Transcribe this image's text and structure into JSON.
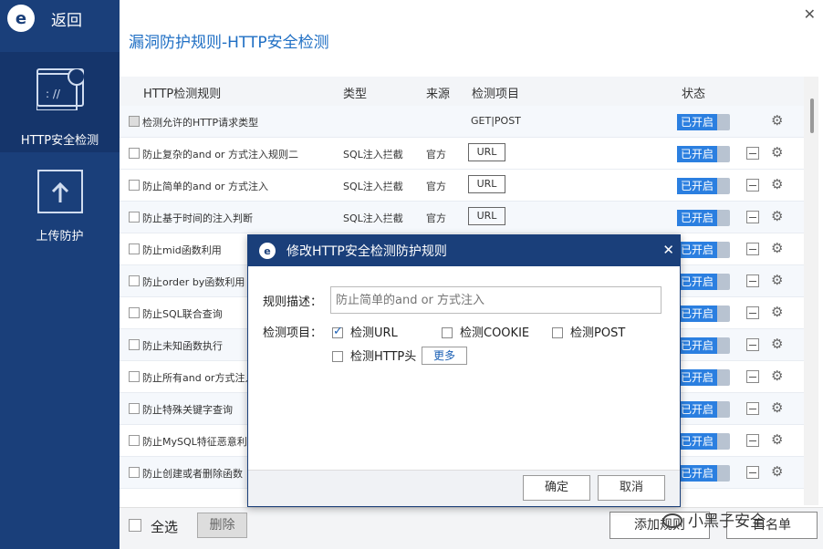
{
  "sidebar": {
    "back_label": "返回",
    "logo_glyph": "e",
    "items": [
      {
        "label": "HTTP安全检测",
        "icon_glyph": ": //"
      },
      {
        "label": "上传防护"
      }
    ]
  },
  "main": {
    "title": "漏洞防护规则-HTTP安全检测",
    "close_glyph": "✕",
    "columns": [
      "HTTP检测规则",
      "类型",
      "来源",
      "检测项目",
      "状态"
    ],
    "rows": [
      {
        "name": "检测允许的HTTP请求类型",
        "type": "",
        "source": "",
        "item": "GET|POST",
        "status": "已开启"
      },
      {
        "name": "防止复杂的and or 方式注入规则二",
        "type": "SQL注入拦截",
        "source": "官方",
        "item": "URL",
        "status": "已开启"
      },
      {
        "name": "防止简单的and or 方式注入",
        "type": "SQL注入拦截",
        "source": "官方",
        "item": "URL",
        "status": "已开启"
      },
      {
        "name": "防止基于时间的注入判断",
        "type": "SQL注入拦截",
        "source": "官方",
        "item": "URL",
        "status": "已开启"
      },
      {
        "name": "防止mid函数利用",
        "status": "已开启"
      },
      {
        "name": "防止order by函数利用",
        "status": "已开启"
      },
      {
        "name": "防止SQL联合查询",
        "status": "已开启"
      },
      {
        "name": "防止未知函数执行",
        "status": "已开启"
      },
      {
        "name": "防止所有and or方式注入",
        "status": "已开启"
      },
      {
        "name": "防止特殊关键字查询",
        "status": "已开启"
      },
      {
        "name": "防止MySQL特征恶意利",
        "status": "已开启"
      },
      {
        "name": "防止创建或者删除函数",
        "status": "已开启"
      }
    ]
  },
  "footer": {
    "select_all": "全选",
    "delete": "删除",
    "add_rule": "添加规则",
    "whitelist": "白名单",
    "watermark": "小黑子安全"
  },
  "dialog": {
    "title": "修改HTTP安全检测防护规则",
    "close_glyph": "✕",
    "desc_label": "规则描述：",
    "desc_value": "防止简单的and or 方式注入",
    "items_label": "检测项目：",
    "options": [
      {
        "label": "检测URL",
        "checked": true
      },
      {
        "label": "检测COOKIE",
        "checked": false
      },
      {
        "label": "检测POST",
        "checked": false
      },
      {
        "label": "检测HTTP头",
        "checked": false
      }
    ],
    "more": "更多",
    "ok": "确定",
    "cancel": "取消"
  },
  "colors": {
    "sidebar": "#1a3f7a",
    "accent": "#1f6fc4",
    "status_on": "#2b7fe0"
  }
}
